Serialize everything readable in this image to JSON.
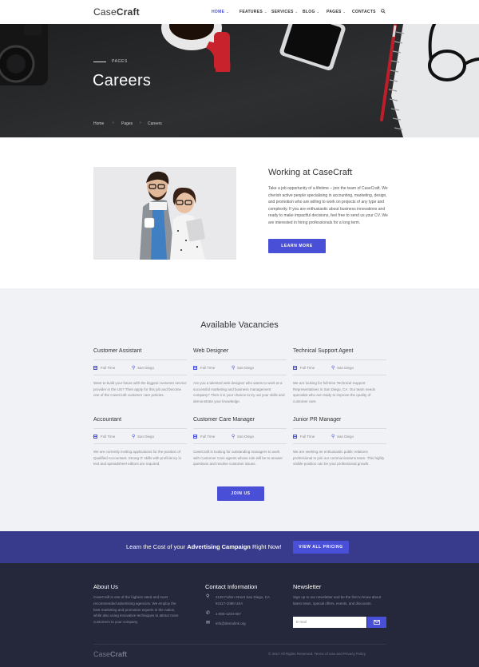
{
  "header": {
    "logo_light": "Case",
    "logo_bold": "Craft",
    "nav": [
      {
        "label": "HOME"
      },
      {
        "label": "FEATURES"
      },
      {
        "label": "SERVICES"
      },
      {
        "label": "BLOG"
      },
      {
        "label": "PAGES"
      },
      {
        "label": "CONTACTS"
      }
    ],
    "accent": "#4a4fd8"
  },
  "hero": {
    "kicker": "PAGES",
    "title": "Careers",
    "breadcrumb": [
      "Home",
      "Pages",
      "Careers"
    ]
  },
  "working": {
    "title": "Working at CaseCraft",
    "text": "Take a job opportunity of a lifetime – join the team of CaseCraft. We cherish active people specialising in accounting, marketing, design, and promotion who are willing to work on projects of any type and complexity. If you are enthusiastic about business innovations and ready to make impactful decisions, feel free to send us your CV. We are interested in hiring professionals for a long term.",
    "button": "LEARN MORE"
  },
  "vacancies": {
    "heading": "Available Vacancies",
    "jobs": [
      {
        "title": "Customer Assistant",
        "type": "Full Time",
        "location": "San Diego",
        "desc": "Want to build your future with the biggest customer service provider in the US? Then apply for this job and become one of the CaseCraft customer care policies."
      },
      {
        "title": "Web Designer",
        "type": "Full Time",
        "location": "San Diego",
        "desc": "Are you a talented web designer who wants to work at a successful marketing and business management company? Then it is your chance to try out your skills and demonstrate your knowledge."
      },
      {
        "title": "Technical Support Agent",
        "type": "Full Time",
        "location": "San Diego",
        "desc": "We are looking for full-time Technical Support Representatives in San Diego, CA. Our team needs specialist who are ready to improve the quality of customer care."
      },
      {
        "title": "Accountant",
        "type": "Full Time",
        "location": "San Diego",
        "desc": "We are currently inviting applications for the position of Qualified Accountant. Strong IT skills with proficiency in text and spreadsheet editors are required."
      },
      {
        "title": "Customer Care Manager",
        "type": "Full Time",
        "location": "San Diego",
        "desc": "CaseCraft is looking for outstanding managers to work with Customer Care agents whose role will be to answer questions and resolve customer issues."
      },
      {
        "title": "Junior PR Manager",
        "type": "Full Time",
        "location": "San Diego",
        "desc": "We are seeking an enthusiastic public relations professional to join our communications team. This highly visible position can be your professional growth."
      }
    ],
    "button": "JOIN US"
  },
  "cta": {
    "prefix": "Learn the Cost of your ",
    "bold": "Advertising Campaign",
    "suffix": " Right Now!",
    "button": "VIEW ALL PRICING"
  },
  "footer": {
    "about_title": "About Us",
    "about_text": "CaseCraft is one of the highest rated and most recommended advertising agencies. We employ the best marketing and promotion experts in the nation, while also using innovative techniques to attract more customers to your company.",
    "contact_title": "Contact Information",
    "address": "2130 Fulton Street San Diego, CA 94117-1080 USA",
    "phone": "1-800-1234-567",
    "email": "info@demolink.org",
    "newsletter_title": "Newsletter",
    "newsletter_text": "Sign up to our newsletter and be the first to know about latest news, special offers, events, and discounts.",
    "email_placeholder": "E-mail",
    "logo_light": "Case",
    "logo_bold": "Craft",
    "copyright": "© 2017 All Rights Reserved. Terms of Use and Privacy Policy"
  }
}
